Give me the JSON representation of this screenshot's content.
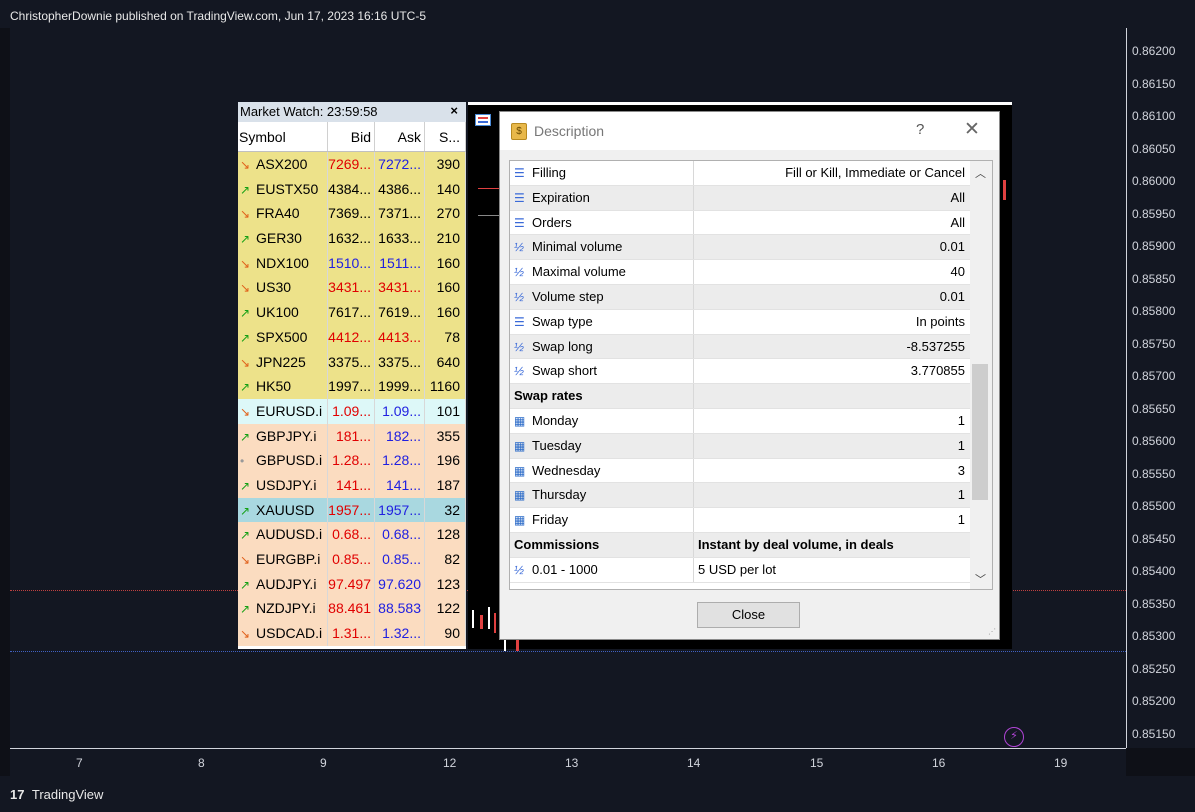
{
  "header": {
    "publisher": "ChristopherDownie published on TradingView.com, Jun 17, 2023 16:16 UTC-5"
  },
  "price_axis": [
    "0.86200",
    "0.86150",
    "0.86100",
    "0.86050",
    "0.86000",
    "0.85950",
    "0.85900",
    "0.85850",
    "0.85800",
    "0.85750",
    "0.85700",
    "0.85650",
    "0.85600",
    "0.85550",
    "0.85500",
    "0.85450",
    "0.85400",
    "0.85350",
    "0.85300",
    "0.85250",
    "0.85200",
    "0.85150"
  ],
  "time_axis": [
    "7",
    "8",
    "9",
    "12",
    "13",
    "14",
    "15",
    "16",
    "19"
  ],
  "footer": {
    "brand": "TradingView",
    "logo": "17"
  },
  "market_watch": {
    "title": "Market Watch: 23:59:58",
    "close": "×",
    "columns": {
      "symbol": "Symbol",
      "bid": "Bid",
      "ask": "Ask",
      "spread": "S..."
    },
    "rows": [
      {
        "dir": "down",
        "symbol": "ASX200",
        "bid": "7269...",
        "ask": "7272...",
        "spread": "390",
        "bg": "#ede28a",
        "bidc": "red",
        "askc": "blue"
      },
      {
        "dir": "up",
        "symbol": "EUSTX50",
        "bid": "4384...",
        "ask": "4386...",
        "spread": "140",
        "bg": "#ede28a",
        "bidc": "black",
        "askc": "black"
      },
      {
        "dir": "down",
        "symbol": "FRA40",
        "bid": "7369...",
        "ask": "7371...",
        "spread": "270",
        "bg": "#ede28a",
        "bidc": "black",
        "askc": "black"
      },
      {
        "dir": "up",
        "symbol": "GER30",
        "bid": "1632...",
        "ask": "1633...",
        "spread": "210",
        "bg": "#ede28a",
        "bidc": "black",
        "askc": "black"
      },
      {
        "dir": "down",
        "symbol": "NDX100",
        "bid": "1510...",
        "ask": "1511...",
        "spread": "160",
        "bg": "#ede28a",
        "bidc": "blue",
        "askc": "blue"
      },
      {
        "dir": "down",
        "symbol": "US30",
        "bid": "3431...",
        "ask": "3431...",
        "spread": "160",
        "bg": "#ede28a",
        "bidc": "red",
        "askc": "red"
      },
      {
        "dir": "up",
        "symbol": "UK100",
        "bid": "7617...",
        "ask": "7619...",
        "spread": "160",
        "bg": "#ede28a",
        "bidc": "black",
        "askc": "black"
      },
      {
        "dir": "up",
        "symbol": "SPX500",
        "bid": "4412...",
        "ask": "4413...",
        "spread": "78",
        "bg": "#ede28a",
        "bidc": "red",
        "askc": "red"
      },
      {
        "dir": "down",
        "symbol": "JPN225",
        "bid": "3375...",
        "ask": "3375...",
        "spread": "640",
        "bg": "#ede28a",
        "bidc": "black",
        "askc": "black"
      },
      {
        "dir": "up",
        "symbol": "HK50",
        "bid": "1997...",
        "ask": "1999...",
        "spread": "1160",
        "bg": "#ede28a",
        "bidc": "black",
        "askc": "black"
      },
      {
        "dir": "down",
        "symbol": "EURUSD.i",
        "bid": "1.09...",
        "ask": "1.09...",
        "spread": "101",
        "bg": "#ddf8f8",
        "bidc": "red",
        "askc": "blue"
      },
      {
        "dir": "up",
        "symbol": "GBPJPY.i",
        "bid": "181...",
        "ask": "182...",
        "spread": "355",
        "bg": "#fbdcc0",
        "bidc": "red",
        "askc": "blue"
      },
      {
        "dir": "neutral",
        "symbol": "GBPUSD.i",
        "bid": "1.28...",
        "ask": "1.28...",
        "spread": "196",
        "bg": "#fbdcc0",
        "bidc": "red",
        "askc": "blue"
      },
      {
        "dir": "up",
        "symbol": "USDJPY.i",
        "bid": "141...",
        "ask": "141...",
        "spread": "187",
        "bg": "#fbdcc0",
        "bidc": "red",
        "askc": "blue"
      },
      {
        "dir": "up",
        "symbol": "XAUUSD",
        "bid": "1957...",
        "ask": "1957...",
        "spread": "32",
        "bg": "#a9d8e0",
        "bidc": "red",
        "askc": "blue"
      },
      {
        "dir": "up",
        "symbol": "AUDUSD.i",
        "bid": "0.68...",
        "ask": "0.68...",
        "spread": "128",
        "bg": "#fbdcc0",
        "bidc": "red",
        "askc": "blue"
      },
      {
        "dir": "down",
        "symbol": "EURGBP.i",
        "bid": "0.85...",
        "ask": "0.85...",
        "spread": "82",
        "bg": "#fbdcc0",
        "bidc": "red",
        "askc": "blue"
      },
      {
        "dir": "up",
        "symbol": "AUDJPY.i",
        "bid": "97.497",
        "ask": "97.620",
        "spread": "123",
        "bg": "#fbdcc0",
        "bidc": "red",
        "askc": "blue"
      },
      {
        "dir": "up",
        "symbol": "NZDJPY.i",
        "bid": "88.461",
        "ask": "88.583",
        "spread": "122",
        "bg": "#fbdcc0",
        "bidc": "red",
        "askc": "blue"
      },
      {
        "dir": "down",
        "symbol": "USDCAD.i",
        "bid": "1.31...",
        "ask": "1.32...",
        "spread": "90",
        "bg": "#fbdcc0",
        "bidc": "red",
        "askc": "blue"
      }
    ]
  },
  "dialog": {
    "title": "Description",
    "help": "?",
    "close_x": "✕",
    "close_button": "Close",
    "rows": [
      {
        "type": "list",
        "label": "Filling",
        "value": "Fill or Kill, Immediate or Cancel"
      },
      {
        "type": "list",
        "label": "Expiration",
        "value": "All"
      },
      {
        "type": "list",
        "label": "Orders",
        "value": "All"
      },
      {
        "type": "half",
        "label": "Minimal volume",
        "value": "0.01"
      },
      {
        "type": "half",
        "label": "Maximal volume",
        "value": "40"
      },
      {
        "type": "half",
        "label": "Volume step",
        "value": "0.01"
      },
      {
        "type": "list",
        "label": "Swap type",
        "value": "In points"
      },
      {
        "type": "half",
        "label": "Swap long",
        "value": "-8.537255"
      },
      {
        "type": "half",
        "label": "Swap short",
        "value": "3.770855"
      },
      {
        "type": "header",
        "label": "Swap rates",
        "value": ""
      },
      {
        "type": "cal",
        "label": "Monday",
        "value": "1"
      },
      {
        "type": "cal",
        "label": "Tuesday",
        "value": "1"
      },
      {
        "type": "cal",
        "label": "Wednesday",
        "value": "3"
      },
      {
        "type": "cal",
        "label": "Thursday",
        "value": "1"
      },
      {
        "type": "cal",
        "label": "Friday",
        "value": "1"
      },
      {
        "type": "header",
        "label": "Commissions",
        "value": "Instant by deal volume, in deals"
      },
      {
        "type": "half-left",
        "label": "0.01 - 1000",
        "value": "5 USD per lot"
      }
    ]
  }
}
